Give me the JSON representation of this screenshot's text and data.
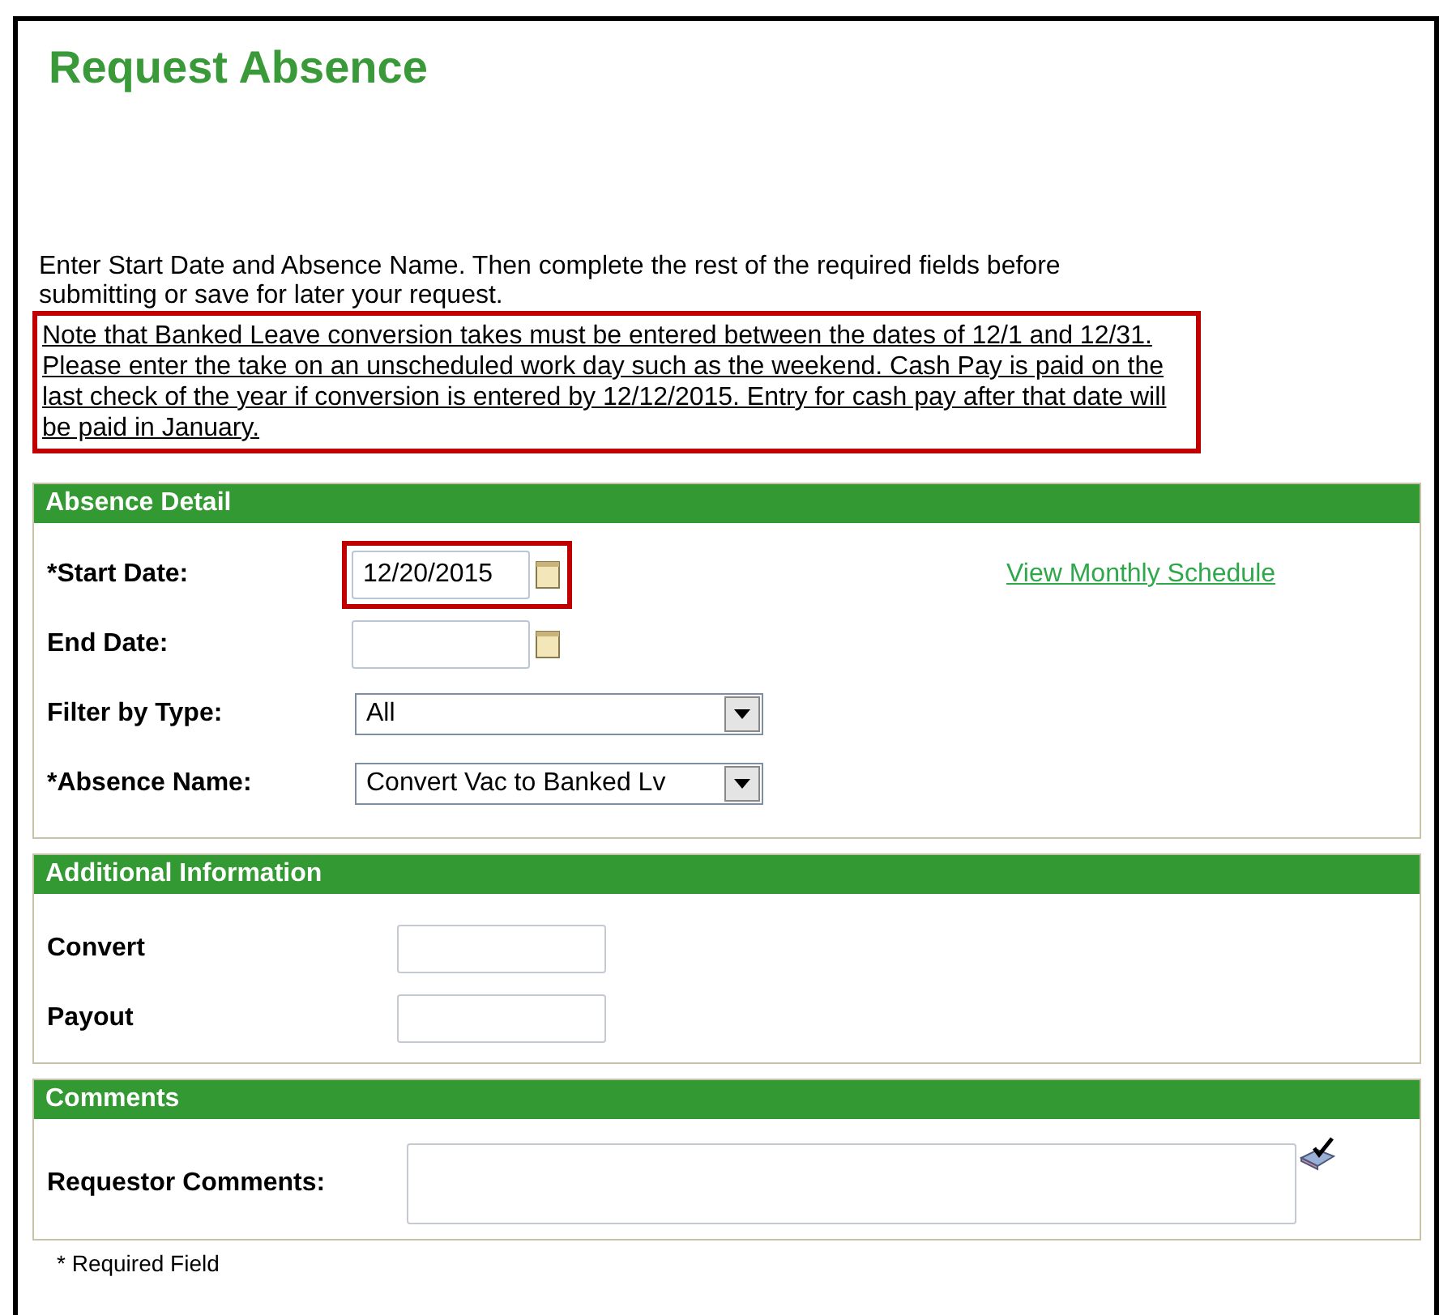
{
  "title": "Request Absence",
  "intro": "Enter Start Date and Absence Name. Then complete the rest of the required fields before submitting or save for later your request.",
  "note": {
    "text": "Note that Banked Leave conversion takes must be entered between the dates of 12/1 and 12/31. Please enter the take on an unscheduled work day such as the weekend. Cash Pay is paid on the last check of the year if conversion is entered by 12/12/2015. Entry for cash pay after that date will be paid in January.",
    "highlighted": true
  },
  "sections": [
    {
      "title": "Absence Detail",
      "link": "View Monthly Schedule",
      "rows": [
        {
          "kind": "date",
          "label": "*Start Date:",
          "value": "12/20/2015",
          "highlighted": true
        },
        {
          "kind": "date",
          "label": "End Date:",
          "highlighted": false
        },
        {
          "kind": "select",
          "label": "Filter by Type:",
          "value": "All"
        },
        {
          "kind": "select",
          "label": "*Absence Name:",
          "value": "Convert Vac to Banked Lv"
        }
      ]
    },
    {
      "title": "Additional Information",
      "rows": [
        {
          "kind": "text",
          "label": "Convert"
        },
        {
          "kind": "text",
          "label": "Payout"
        }
      ]
    },
    {
      "title": "Comments",
      "rows": [
        {
          "kind": "textarea",
          "label": "Requestor Comments:"
        }
      ]
    }
  ],
  "footnote": "* Required Field"
}
